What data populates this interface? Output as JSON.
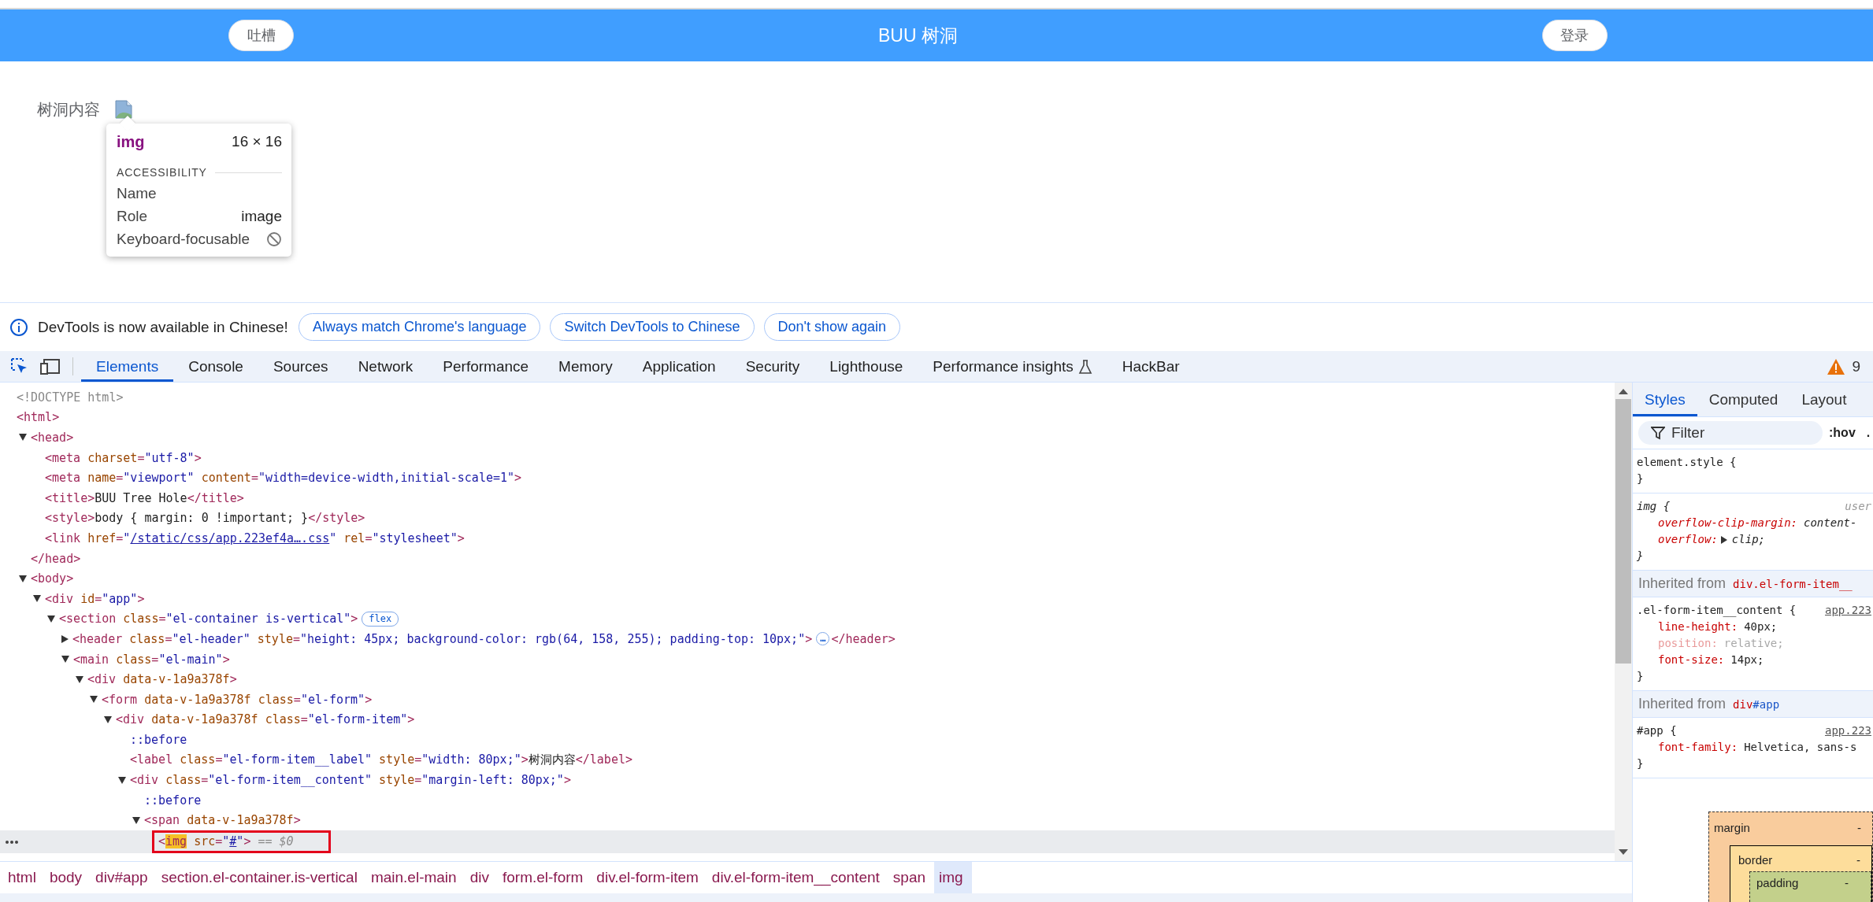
{
  "page": {
    "header": {
      "left_button": "吐槽",
      "title": "BUU 树洞",
      "right_button": "登录"
    },
    "form": {
      "label": "树洞内容"
    },
    "tooltip": {
      "tag": "img",
      "size": "16 × 16",
      "section": "ACCESSIBILITY",
      "rows": [
        {
          "kind": "text",
          "label": "Name"
        },
        {
          "kind": "text",
          "label": "Role",
          "value": "image"
        },
        {
          "kind": "state",
          "label": "Keyboard-focusable",
          "focusable": false
        }
      ]
    }
  },
  "devtools": {
    "banner": {
      "message": "DevTools is now available in Chinese!",
      "buttons": [
        "Always match Chrome's language",
        "Switch DevTools to Chinese",
        "Don't show again"
      ]
    },
    "tabs": [
      {
        "label": "Elements",
        "selected": true
      },
      {
        "label": "Console",
        "selected": false
      },
      {
        "label": "Sources",
        "selected": false
      },
      {
        "label": "Network",
        "selected": false
      },
      {
        "label": "Performance",
        "selected": false
      },
      {
        "label": "Memory",
        "selected": false
      },
      {
        "label": "Application",
        "selected": false
      },
      {
        "label": "Security",
        "selected": false
      },
      {
        "label": "Lighthouse",
        "selected": false
      },
      {
        "label": "Performance insights",
        "selected": false,
        "kind": "experimental"
      },
      {
        "label": "HackBar",
        "selected": false
      }
    ],
    "issues_count": "9",
    "dom_tree": [
      {
        "selected": false,
        "tokens": [
          {
            "kind": "doctype",
            "text": "<!DOCTYPE html>"
          }
        ]
      },
      {
        "selected": false,
        "tokens": [
          {
            "kind": "tag",
            "text": "<html>"
          }
        ],
        "children": [
          {
            "selected": false,
            "expanded": true,
            "tokens": [
              {
                "kind": "tag",
                "text": "<head>"
              }
            ],
            "children": [
              {
                "selected": false,
                "tokens": [
                  {
                    "kind": "tag",
                    "text": "<meta"
                  },
                  {
                    "kind": "attr",
                    "text": " charset"
                  },
                  {
                    "kind": "tag",
                    "text": "="
                  },
                  {
                    "kind": "value",
                    "text": "\"utf-8\""
                  },
                  {
                    "kind": "tag",
                    "text": ">"
                  }
                ]
              },
              {
                "selected": false,
                "tokens": [
                  {
                    "kind": "tag",
                    "text": "<meta"
                  },
                  {
                    "kind": "attr",
                    "text": " name"
                  },
                  {
                    "kind": "tag",
                    "text": "="
                  },
                  {
                    "kind": "value",
                    "text": "\"viewport\""
                  },
                  {
                    "kind": "attr",
                    "text": " content"
                  },
                  {
                    "kind": "tag",
                    "text": "="
                  },
                  {
                    "kind": "value",
                    "text": "\"width=device-width,initial-scale=1\""
                  },
                  {
                    "kind": "tag",
                    "text": ">"
                  }
                ]
              },
              {
                "selected": false,
                "tokens": [
                  {
                    "kind": "tag",
                    "text": "<title>"
                  },
                  {
                    "kind": "text",
                    "text": "BUU Tree Hole"
                  },
                  {
                    "kind": "tag",
                    "text": "</title>"
                  }
                ]
              },
              {
                "selected": false,
                "tokens": [
                  {
                    "kind": "tag",
                    "text": "<style>"
                  },
                  {
                    "kind": "text",
                    "text": "body { margin: 0 !important; }"
                  },
                  {
                    "kind": "tag",
                    "text": "</style>"
                  }
                ]
              },
              {
                "selected": false,
                "tokens": [
                  {
                    "kind": "tag",
                    "text": "<link"
                  },
                  {
                    "kind": "attr",
                    "text": " href"
                  },
                  {
                    "kind": "tag",
                    "text": "="
                  },
                  {
                    "kind": "value",
                    "text": "\""
                  },
                  {
                    "kind": "link",
                    "text": "/static/css/app.223ef4a….css"
                  },
                  {
                    "kind": "value",
                    "text": "\""
                  },
                  {
                    "kind": "attr",
                    "text": " rel"
                  },
                  {
                    "kind": "tag",
                    "text": "="
                  },
                  {
                    "kind": "value",
                    "text": "\"stylesheet\""
                  },
                  {
                    "kind": "tag",
                    "text": ">"
                  }
                ]
              }
            ],
            "closing": [
              {
                "kind": "tag",
                "text": "</head>"
              }
            ]
          },
          {
            "selected": false,
            "expanded": true,
            "tokens": [
              {
                "kind": "tag",
                "text": "<body>"
              }
            ],
            "children": [
              {
                "selected": false,
                "expanded": true,
                "tokens": [
                  {
                    "kind": "tag",
                    "text": "<div"
                  },
                  {
                    "kind": "attr",
                    "text": " id"
                  },
                  {
                    "kind": "tag",
                    "text": "="
                  },
                  {
                    "kind": "value",
                    "text": "\"app\""
                  },
                  {
                    "kind": "tag",
                    "text": ">"
                  }
                ],
                "children": [
                  {
                    "selected": false,
                    "expanded": true,
                    "tokens": [
                      {
                        "kind": "tag",
                        "text": "<section"
                      },
                      {
                        "kind": "attr",
                        "text": " class"
                      },
                      {
                        "kind": "tag",
                        "text": "="
                      },
                      {
                        "kind": "value",
                        "text": "\"el-container is-vertical\""
                      },
                      {
                        "kind": "tag",
                        "text": ">"
                      },
                      {
                        "kind": "badge",
                        "text": "flex"
                      }
                    ],
                    "children": [
                      {
                        "selected": false,
                        "expanded": false,
                        "tokens": [
                          {
                            "kind": "tag",
                            "text": "<header"
                          },
                          {
                            "kind": "attr",
                            "text": " class"
                          },
                          {
                            "kind": "tag",
                            "text": "="
                          },
                          {
                            "kind": "value",
                            "text": "\"el-header\""
                          },
                          {
                            "kind": "attr",
                            "text": " style"
                          },
                          {
                            "kind": "tag",
                            "text": "="
                          },
                          {
                            "kind": "value",
                            "text": "\"height: 45px; background-color: rgb(64, 158, 255); padding-top: 10px;\""
                          },
                          {
                            "kind": "tag",
                            "text": ">"
                          },
                          {
                            "kind": "ellipsis",
                            "text": "…"
                          },
                          {
                            "kind": "tag",
                            "text": "</header>"
                          }
                        ]
                      },
                      {
                        "selected": false,
                        "expanded": true,
                        "tokens": [
                          {
                            "kind": "tag",
                            "text": "<main"
                          },
                          {
                            "kind": "attr",
                            "text": " class"
                          },
                          {
                            "kind": "tag",
                            "text": "="
                          },
                          {
                            "kind": "value",
                            "text": "\"el-main\""
                          },
                          {
                            "kind": "tag",
                            "text": ">"
                          }
                        ],
                        "children": [
                          {
                            "selected": false,
                            "expanded": true,
                            "tokens": [
                              {
                                "kind": "tag",
                                "text": "<div"
                              },
                              {
                                "kind": "attr",
                                "text": " data-v-1a9a378f"
                              },
                              {
                                "kind": "tag",
                                "text": ">"
                              }
                            ],
                            "children": [
                              {
                                "selected": false,
                                "expanded": true,
                                "tokens": [
                                  {
                                    "kind": "tag",
                                    "text": "<form"
                                  },
                                  {
                                    "kind": "attr",
                                    "text": " data-v-1a9a378f class"
                                  },
                                  {
                                    "kind": "tag",
                                    "text": "="
                                  },
                                  {
                                    "kind": "value",
                                    "text": "\"el-form\""
                                  },
                                  {
                                    "kind": "tag",
                                    "text": ">"
                                  }
                                ],
                                "children": [
                                  {
                                    "selected": false,
                                    "expanded": true,
                                    "tokens": [
                                      {
                                        "kind": "tag",
                                        "text": "<div"
                                      },
                                      {
                                        "kind": "attr",
                                        "text": " data-v-1a9a378f class"
                                      },
                                      {
                                        "kind": "tag",
                                        "text": "="
                                      },
                                      {
                                        "kind": "value",
                                        "text": "\"el-form-item\""
                                      },
                                      {
                                        "kind": "tag",
                                        "text": ">"
                                      }
                                    ],
                                    "children": [
                                      {
                                        "selected": false,
                                        "tokens": [
                                          {
                                            "kind": "pseudo",
                                            "text": "::before"
                                          }
                                        ]
                                      },
                                      {
                                        "selected": false,
                                        "tokens": [
                                          {
                                            "kind": "tag",
                                            "text": "<label"
                                          },
                                          {
                                            "kind": "attr",
                                            "text": " class"
                                          },
                                          {
                                            "kind": "tag",
                                            "text": "="
                                          },
                                          {
                                            "kind": "value",
                                            "text": "\"el-form-item__label\""
                                          },
                                          {
                                            "kind": "attr",
                                            "text": " style"
                                          },
                                          {
                                            "kind": "tag",
                                            "text": "="
                                          },
                                          {
                                            "kind": "value",
                                            "text": "\"width: 80px;\""
                                          },
                                          {
                                            "kind": "tag",
                                            "text": ">"
                                          },
                                          {
                                            "kind": "text",
                                            "text": "树洞内容"
                                          },
                                          {
                                            "kind": "tag",
                                            "text": "</label>"
                                          }
                                        ]
                                      },
                                      {
                                        "selected": false,
                                        "expanded": true,
                                        "tokens": [
                                          {
                                            "kind": "tag",
                                            "text": "<div"
                                          },
                                          {
                                            "kind": "attr",
                                            "text": " class"
                                          },
                                          {
                                            "kind": "tag",
                                            "text": "="
                                          },
                                          {
                                            "kind": "value",
                                            "text": "\"el-form-item__content\""
                                          },
                                          {
                                            "kind": "attr",
                                            "text": " style"
                                          },
                                          {
                                            "kind": "tag",
                                            "text": "="
                                          },
                                          {
                                            "kind": "value",
                                            "text": "\"margin-left: 80px;\""
                                          },
                                          {
                                            "kind": "tag",
                                            "text": ">"
                                          }
                                        ],
                                        "children": [
                                          {
                                            "selected": false,
                                            "tokens": [
                                              {
                                                "kind": "pseudo",
                                                "text": "::before"
                                              }
                                            ]
                                          },
                                          {
                                            "selected": false,
                                            "expanded": true,
                                            "tokens": [
                                              {
                                                "kind": "tag",
                                                "text": "<span"
                                              },
                                              {
                                                "kind": "attr",
                                                "text": " data-v-1a9a378f"
                                              },
                                              {
                                                "kind": "tag",
                                                "text": ">"
                                              }
                                            ],
                                            "children": [
                                              {
                                                "selected": true,
                                                "annotated": true,
                                                "tokens": [
                                                  {
                                                    "kind": "tag",
                                                    "text": "<"
                                                  },
                                                  {
                                                    "kind": "match",
                                                    "text": "img"
                                                  },
                                                  {
                                                    "kind": "attr",
                                                    "text": " src"
                                                  },
                                                  {
                                                    "kind": "tag",
                                                    "text": "="
                                                  },
                                                  {
                                                    "kind": "value",
                                                    "text": "\""
                                                  },
                                                  {
                                                    "kind": "link",
                                                    "text": "#"
                                                  },
                                                  {
                                                    "kind": "value",
                                                    "text": "\""
                                                  },
                                                  {
                                                    "kind": "tag",
                                                    "text": ">"
                                                  },
                                                  {
                                                    "kind": "console",
                                                    "text": " == $0"
                                                  }
                                                ]
                                              }
                                            ]
                                          }
                                        ]
                                      }
                                    ]
                                  }
                                ]
                              }
                            ]
                          }
                        ]
                      }
                    ]
                  }
                ]
              }
            ]
          }
        ]
      }
    ],
    "breadcrumbs": [
      {
        "label": "html",
        "selected": false
      },
      {
        "label": "body",
        "selected": false
      },
      {
        "label": "div#app",
        "selected": false
      },
      {
        "label": "section.el-container.is-vertical",
        "selected": false
      },
      {
        "label": "main.el-main",
        "selected": false
      },
      {
        "label": "div",
        "selected": false
      },
      {
        "label": "form.el-form",
        "selected": false
      },
      {
        "label": "div.el-form-item",
        "selected": false
      },
      {
        "label": "div.el-form-item__content",
        "selected": false
      },
      {
        "label": "span",
        "selected": false
      },
      {
        "label": "img",
        "selected": true
      }
    ],
    "styles_pane": {
      "tabs": [
        {
          "label": "Styles",
          "selected": true
        },
        {
          "label": "Computed",
          "selected": false
        },
        {
          "label": "Layout",
          "selected": false
        }
      ],
      "filter": {
        "placeholder": "Filter"
      },
      "hov": ":hov",
      "cls": ".",
      "sections": [
        {
          "kind": "rule",
          "selector": "element.style {",
          "user_agent": false,
          "close": "}"
        },
        {
          "kind": "rule",
          "selector": "img {",
          "source": "user",
          "user_agent": true,
          "close": "}",
          "declarations": [
            {
              "property": "overflow-clip-margin:",
              "value": "content-",
              "inactive": false,
              "expandable": false
            },
            {
              "property": "overflow:",
              "value": "clip;",
              "inactive": false,
              "expandable": true
            }
          ]
        },
        {
          "kind": "inherited",
          "label": "Inherited from",
          "element": [
            {
              "kind": "tag",
              "text": "div.el-form-item__"
            }
          ]
        },
        {
          "kind": "rule",
          "selector": ".el-form-item__content {",
          "source": "app.223",
          "user_agent": false,
          "close": "}",
          "declarations": [
            {
              "property": "line-height:",
              "value": "40px;",
              "inactive": false,
              "expandable": false
            },
            {
              "property": "position:",
              "value": "relative;",
              "inactive": true,
              "expandable": false
            },
            {
              "property": "font-size:",
              "value": "14px;",
              "inactive": false,
              "expandable": false
            }
          ]
        },
        {
          "kind": "inherited",
          "label": "Inherited from",
          "element": [
            {
              "kind": "tag",
              "text": "div"
            },
            {
              "kind": "id",
              "text": "#app"
            }
          ]
        },
        {
          "kind": "rule",
          "selector": "#app {",
          "source": "app.223",
          "user_agent": false,
          "close": "}",
          "declarations": [
            {
              "property": "font-family:",
              "value": "Helvetica, sans-s",
              "inactive": false,
              "expandable": false
            }
          ]
        }
      ],
      "box_model": {
        "margin": {
          "label": "margin",
          "value": "-"
        },
        "border": {
          "label": "border",
          "value": "-"
        },
        "padding": {
          "label": "padding",
          "value": "-"
        }
      }
    }
  }
}
